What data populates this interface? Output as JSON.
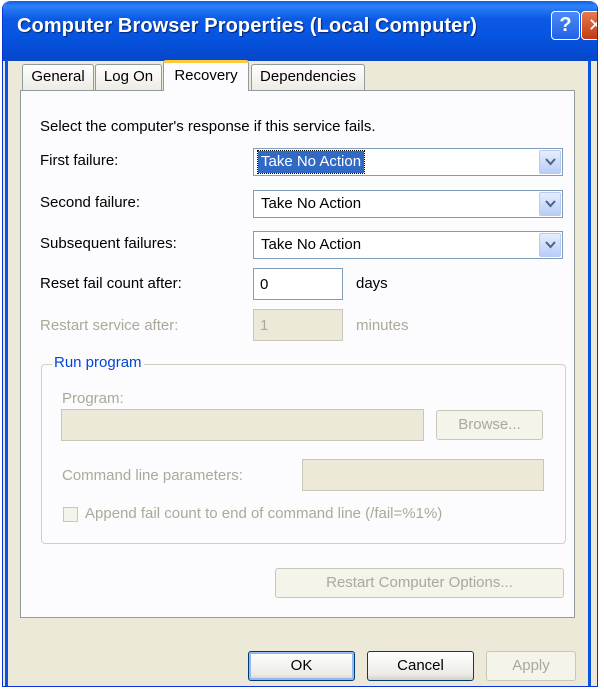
{
  "window": {
    "title": "Computer Browser Properties (Local Computer)",
    "help_glyph": "?",
    "close_glyph": "✕"
  },
  "tabs": [
    {
      "label": "General"
    },
    {
      "label": "Log On"
    },
    {
      "label": "Recovery"
    },
    {
      "label": "Dependencies"
    }
  ],
  "recovery": {
    "intro": "Select the computer's response if this service fails.",
    "first_failure": {
      "label": "First failure:",
      "value": "Take No Action"
    },
    "second_failure": {
      "label": "Second failure:",
      "value": "Take No Action"
    },
    "subsequent_failures": {
      "label": "Subsequent failures:",
      "value": "Take No Action"
    },
    "reset_fail_count": {
      "label": "Reset fail count after:",
      "value": "0",
      "unit": "days"
    },
    "restart_service": {
      "label": "Restart service after:",
      "value": "1",
      "unit": "minutes"
    },
    "run_program": {
      "title": "Run program",
      "program_label": "Program:",
      "program_value": "",
      "browse_label": "Browse...",
      "cmd_label": "Command line parameters:",
      "cmd_value": "",
      "append_label": "Append fail count to end of command line (/fail=%1%)"
    },
    "restart_options_label": "Restart Computer Options..."
  },
  "footer": {
    "ok_label": "OK",
    "cancel_label": "Cancel",
    "apply_label": "Apply"
  }
}
